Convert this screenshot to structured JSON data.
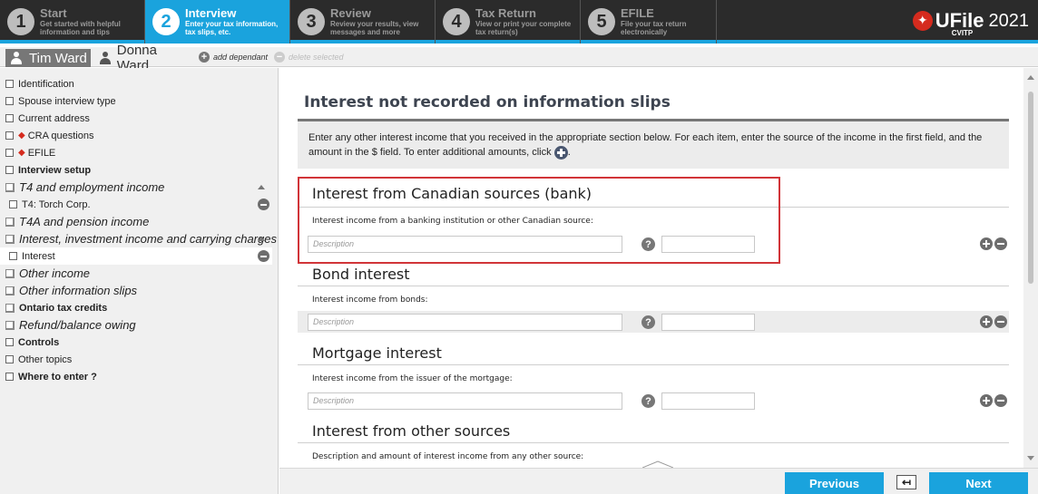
{
  "steps": [
    {
      "num": "1",
      "title": "Start",
      "desc": "Get started with helpful information and tips"
    },
    {
      "num": "2",
      "title": "Interview",
      "desc": "Enter your tax information, tax slips, etc."
    },
    {
      "num": "3",
      "title": "Review",
      "desc": "Review your results, view messages and more"
    },
    {
      "num": "4",
      "title": "Tax Return",
      "desc": "View or print your complete tax return(s)"
    },
    {
      "num": "5",
      "title": "EFILE",
      "desc": "File your tax return electronically"
    }
  ],
  "logo": {
    "brand": "UFile",
    "sub": "CVITP",
    "year": "2021"
  },
  "people": {
    "primary": "Tim Ward",
    "spouse": "Donna Ward",
    "add": "add dependant",
    "delete": "delete selected"
  },
  "sidebar": {
    "items": [
      {
        "label": "Identification"
      },
      {
        "label": "Spouse interview type"
      },
      {
        "label": "Current address"
      },
      {
        "label": "CRA questions"
      },
      {
        "label": "EFILE"
      },
      {
        "label": "Interview setup"
      },
      {
        "label": "T4 and employment income"
      },
      {
        "label": "T4: Torch Corp."
      },
      {
        "label": "T4A and pension income"
      },
      {
        "label": "Interest, investment income and carrying charges"
      },
      {
        "label": "Interest"
      },
      {
        "label": "Other income"
      },
      {
        "label": "Other information slips"
      },
      {
        "label": "Ontario tax credits"
      },
      {
        "label": "Refund/balance owing"
      },
      {
        "label": "Controls"
      },
      {
        "label": "Other topics"
      },
      {
        "label": "Where to enter ?"
      }
    ]
  },
  "main": {
    "title": "Interest not recorded on information slips",
    "intro_line1": "Enter any other interest income that you received in the appropriate section below. For each item, enter the source of the income in the first field, and the",
    "intro_line2": "amount in the $ field. To enter additional amounts, click",
    "intro_end": ".",
    "description_placeholder": "Description",
    "help_glyph": "?",
    "sections": [
      {
        "title": "Interest from Canadian sources (bank)",
        "label": "Interest income from a banking institution or other Canadian source:"
      },
      {
        "title": "Bond interest",
        "label": "Interest income from bonds:"
      },
      {
        "title": "Mortgage interest",
        "label": "Interest income from the issuer of the mortgage:"
      },
      {
        "title": "Interest from other sources",
        "label": "Description and amount of interest income from any other source:"
      }
    ]
  },
  "buttons": {
    "previous": "Previous",
    "back_glyph": "↤",
    "next": "Next"
  },
  "colors": {
    "accent": "#1aa3dd",
    "highlight": "#d13438",
    "maple": "#d52b1e"
  }
}
